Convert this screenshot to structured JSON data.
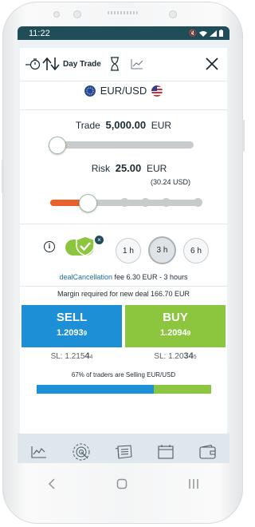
{
  "status": {
    "time": "11:22"
  },
  "toolbar": {
    "title": "Day Trade"
  },
  "pair": {
    "label": "EUR/USD"
  },
  "trade": {
    "label": "Trade",
    "amount": "5,000.00",
    "currency": "EUR",
    "level": 0.05
  },
  "risk": {
    "label": "Risk",
    "amount": "25.00",
    "currency": "EUR",
    "converted": "(30.24 USD)",
    "level": 0.25
  },
  "deal_cancellation": {
    "enabled": true,
    "durations": [
      "1 h",
      "3 h",
      "6 h"
    ],
    "selected": "3 h",
    "link": "dealCancellation",
    "fee_text": "fee 6.30 EUR - 3 hours"
  },
  "margin": {
    "text": "Margin required for new deal 166.70 EUR"
  },
  "sell": {
    "label": "SELL",
    "price_main": "1.2093",
    "price_pip": "9",
    "sl_prefix": "SL: 1.215",
    "sl_bold": "4",
    "sl_sup": "4"
  },
  "buy": {
    "label": "BUY",
    "price_main": "1.2094",
    "price_pip": "9",
    "sl_prefix": "SL: 1.20",
    "sl_bold": "34",
    "sl_sup": "5"
  },
  "sentiment": {
    "text": "67% of traders are Selling EUR/USD",
    "sell_percent": 67
  },
  "nav": [
    "chart-icon",
    "radar-icon",
    "news-icon",
    "calendar-icon",
    "wallet-icon"
  ],
  "colors": {
    "sell": "#1d8fd6",
    "buy": "#8cc63f",
    "risk_accent": "#e8602c",
    "statusbar": "#1f4e58"
  }
}
